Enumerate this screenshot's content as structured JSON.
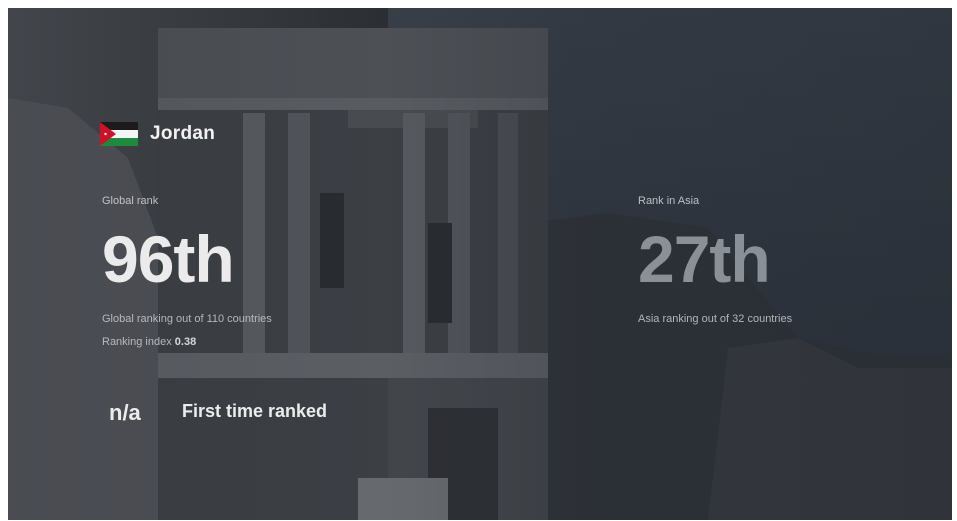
{
  "country": {
    "name": "Jordan",
    "flag_icon": "jordan-flag-icon",
    "flag_colors": {
      "black": "#1b1b1b",
      "white": "#f4f4f4",
      "green": "#1d8a3e",
      "red": "#ce1126"
    }
  },
  "global": {
    "label": "Global rank",
    "rank": "96th",
    "description": "Global ranking out of 110 countries",
    "index_label": "Ranking index",
    "index_value": "0.38"
  },
  "asia": {
    "label": "Rank in Asia",
    "rank": "27th",
    "description": "Asia ranking out of 32 countries"
  },
  "change": {
    "value": "n/a",
    "text": "First time ranked"
  }
}
